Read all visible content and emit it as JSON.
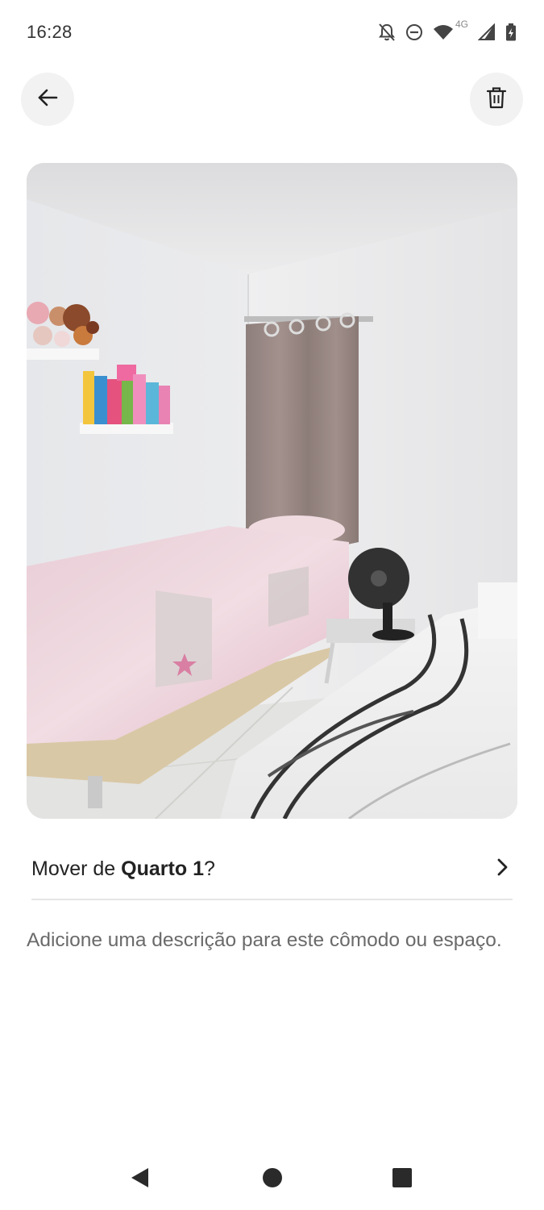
{
  "status_bar": {
    "time": "16:28",
    "network_label": "4G",
    "icons": [
      "notifications-off-icon",
      "do-not-disturb-icon",
      "wifi-icon",
      "cellular-signal-icon",
      "battery-charging-icon"
    ]
  },
  "top_bar": {
    "back_icon": "arrow-left-icon",
    "delete_icon": "trash-icon"
  },
  "photo": {
    "subject": "bedroom-photo"
  },
  "move_row": {
    "prefix": "Mover de ",
    "room": "Quarto 1",
    "suffix": "?",
    "icon": "chevron-right-icon"
  },
  "description": {
    "placeholder": "Adicione uma descrição para este cômodo ou espaço."
  },
  "nav_bar": {
    "icons": [
      "back-triangle-icon",
      "home-circle-icon",
      "recents-square-icon"
    ]
  },
  "colors": {
    "background": "#ffffff",
    "text_primary": "#222222",
    "text_secondary": "#6a6a6a",
    "button_bg": "#f2f2f2",
    "divider": "#e6e6e6"
  }
}
